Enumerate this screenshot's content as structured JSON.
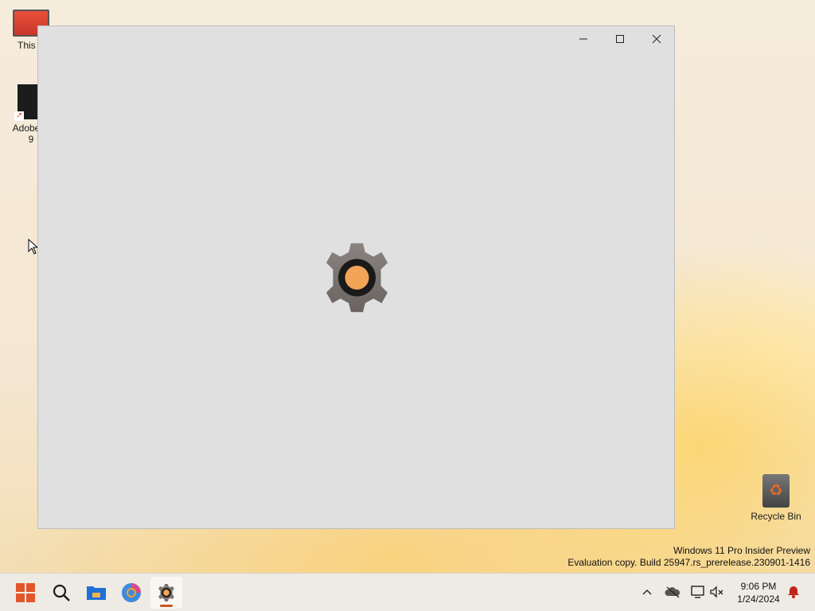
{
  "desktop": {
    "icons": [
      {
        "label": "This P"
      },
      {
        "label": "Adobe R",
        "label2": "9"
      }
    ],
    "recycle_bin": {
      "label": "Recycle Bin"
    }
  },
  "window": {
    "state": "loading",
    "splash_icon": "gear-icon",
    "colors": {
      "background": "#e0e0e0",
      "gear": "#7a7370",
      "center": "#f2a457"
    }
  },
  "watermark": {
    "line1": "Windows 11 Pro Insider Preview",
    "line2": "Evaluation copy. Build 25947.rs_prerelease.230901-1416"
  },
  "taskbar": {
    "apps": [
      {
        "name": "Start",
        "icon": "windows-logo-icon"
      },
      {
        "name": "Search",
        "icon": "search-icon"
      },
      {
        "name": "File Explorer",
        "icon": "folder-icon"
      },
      {
        "name": "Browser",
        "icon": "browser-icon"
      },
      {
        "name": "Settings",
        "icon": "gear-icon",
        "active": true
      }
    ],
    "tray": {
      "time": "9:06 PM",
      "date": "1/24/2024"
    }
  }
}
